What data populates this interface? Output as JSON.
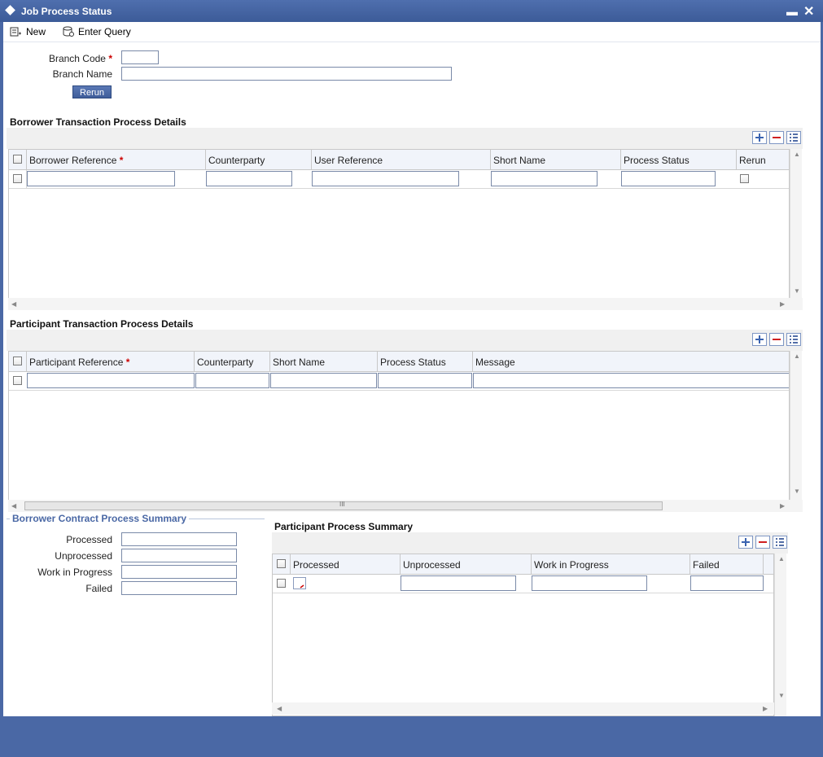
{
  "window": {
    "title": "Job Process Status"
  },
  "toolbar": {
    "new_label": "New",
    "enter_query_label": "Enter Query"
  },
  "form": {
    "branch_code_label": "Branch Code",
    "branch_code_value": "",
    "branch_name_label": "Branch Name",
    "branch_name_value": "",
    "rerun_label": "Rerun",
    "required_mark": "*"
  },
  "borrower_section": {
    "title": "Borrower Transaction Process Details",
    "columns": [
      "Borrower Reference",
      "Counterparty",
      "User Reference",
      "Short Name",
      "Process Status",
      "Rerun"
    ]
  },
  "participant_section": {
    "title": "Participant Transaction Process Details",
    "columns": [
      "Participant Reference",
      "Counterparty",
      "Short Name",
      "Process Status",
      "Message"
    ]
  },
  "borrower_summary": {
    "title": "Borrower Contract Process Summary",
    "processed_label": "Processed",
    "unprocessed_label": "Unprocessed",
    "wip_label": "Work in Progress",
    "failed_label": "Failed"
  },
  "participant_summary": {
    "title": "Participant Process Summary",
    "columns": [
      "Processed",
      "Unprocessed",
      "Work in Progress",
      "Failed"
    ]
  },
  "scroll": {
    "thumb_grip": "III"
  },
  "colors": {
    "accent": "#4a68a5",
    "required": "#cc0000",
    "header_bg": "#f1f4fa"
  }
}
